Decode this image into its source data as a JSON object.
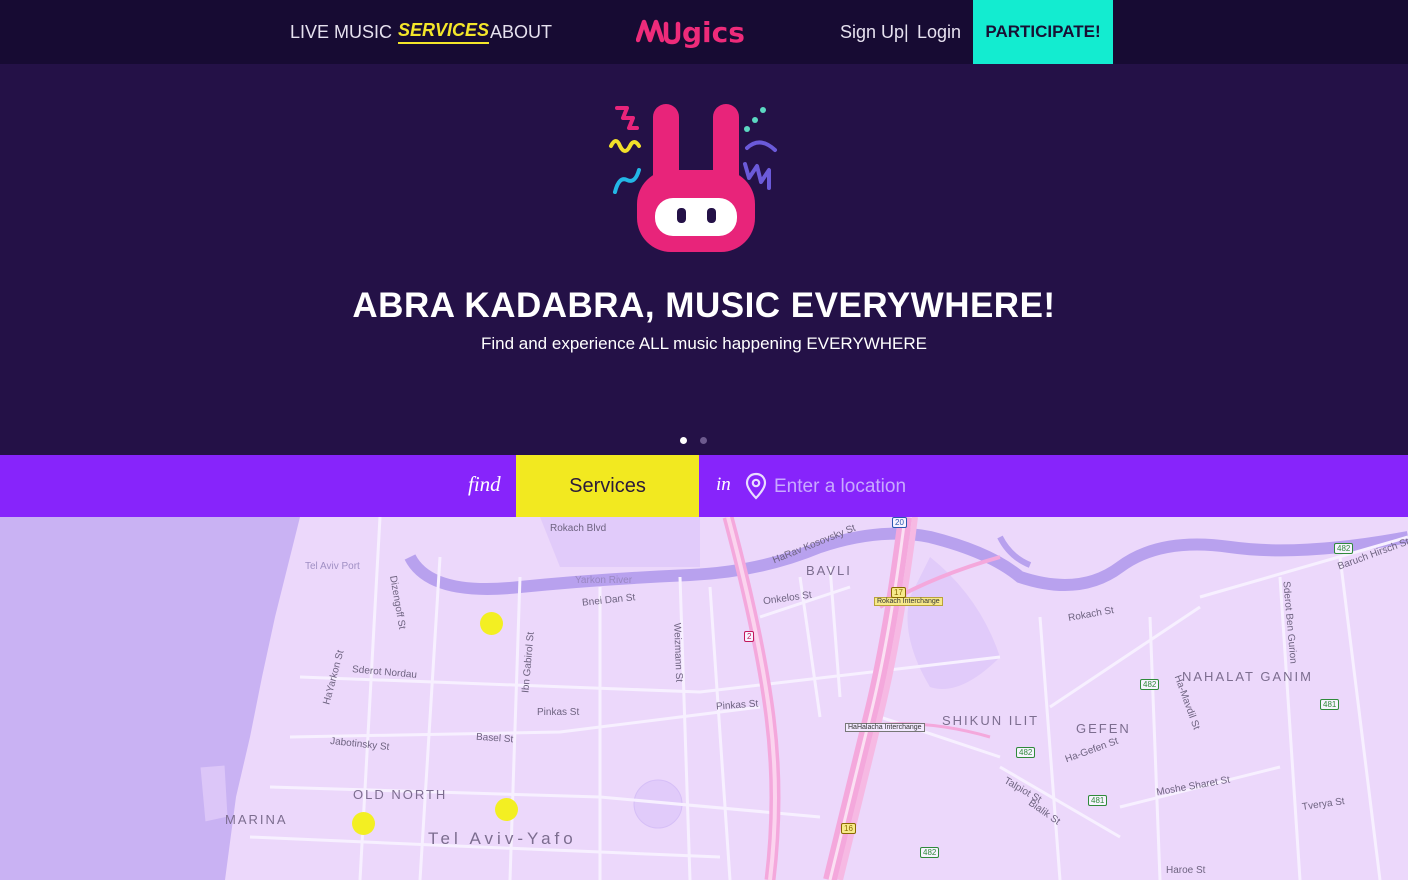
{
  "nav": {
    "live_music": "LIVE MUSIC",
    "services": "SERVICES",
    "about": "ABOUT",
    "brand": "Mugics",
    "sign_up": "Sign Up",
    "separator": "|",
    "login": "Login",
    "participate": "PARTICIPATE!"
  },
  "hero": {
    "headline": "ABRA KADABRA, MUSIC EVERYWHERE!",
    "subline": "Find and experience ALL music happening EVERYWHERE",
    "slides": 2,
    "active_slide": 1
  },
  "search": {
    "find_label": "find",
    "category": "Services",
    "in_label": "in",
    "location_placeholder": "Enter a location",
    "location_value": ""
  },
  "map": {
    "areas": [
      "BAVLI",
      "NAHALAT GANIM",
      "SHIKUN ILIT",
      "GEFEN",
      "OLD NORTH",
      "MARINA"
    ],
    "city": "Tel Aviv-Yafo",
    "streets": [
      "Rokach Blvd",
      "HaRav Kosovsky St",
      "Bnei Dan St",
      "Onkelos St",
      "Sderot Nordau",
      "Pinkas St",
      "Basel St",
      "Jabotinsky St",
      "Dizengoff St",
      "HaYarkon St",
      "Weizmann St",
      "Ibn Gabirol St",
      "Yarkon River",
      "Tel Aviv Port",
      "Pinkas St",
      "Sderot Ben Gurion",
      "Ha-Gefen St",
      "Bialik St",
      "Moshe Sharet St",
      "Tverya St",
      "Haroe St",
      "Rokach St",
      "Talpiot St",
      "Ha-Mavdil St",
      "Baruch Hirsch St"
    ],
    "interchanges": [
      "Rokach Interchange",
      "HaHalacha Interchange"
    ],
    "route_shields": [
      "20",
      "2",
      "17",
      "482",
      "481",
      "16"
    ],
    "colors": {
      "land": "#ecd8fb",
      "sea": "#c8b2f4",
      "marker": "#f3ef22",
      "highway": "#f6a3d8"
    }
  }
}
